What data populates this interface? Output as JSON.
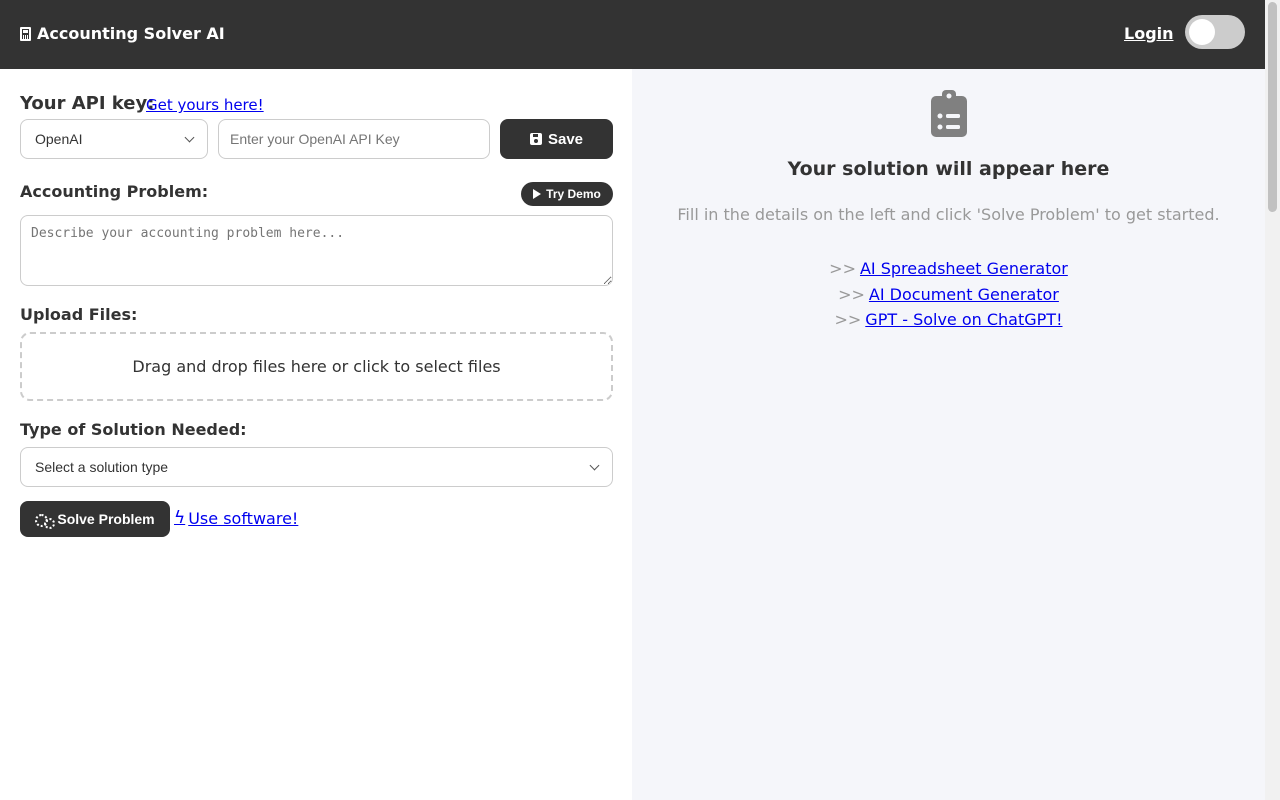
{
  "header": {
    "brand_title": "Accounting Solver AI",
    "login_label": "Login"
  },
  "api_section": {
    "label": "Your API key:",
    "link_text": "Get yours here!",
    "provider_selected": "OpenAI",
    "input_placeholder": "Enter your OpenAI API Key",
    "save_label": "Save"
  },
  "problem_section": {
    "label": "Accounting Problem:",
    "demo_label": "Try Demo",
    "textarea_placeholder": "Describe your accounting problem here..."
  },
  "upload_section": {
    "label": "Upload Files:",
    "dropzone_text": "Drag and drop files here or click to select files"
  },
  "solution_type_section": {
    "label": "Type of Solution Needed:",
    "selected": "Select a solution type"
  },
  "actions": {
    "solve_label": "Solve Problem",
    "software_link": "Use software!"
  },
  "result_panel": {
    "title": "Your solution will appear here",
    "subtitle": "Fill in the details on the left and click 'Solve Problem' to get started.",
    "links": [
      {
        "prefix": ">>",
        "label": "AI Spreadsheet Generator"
      },
      {
        "prefix": ">>",
        "label": "AI Document Generator"
      },
      {
        "prefix": ">>",
        "label": "GPT - Solve on ChatGPT!"
      }
    ]
  },
  "colors": {
    "header_bg": "#333333",
    "button_bg": "#333333",
    "link": "#0000ee",
    "right_panel_bg": "#f5f6fa",
    "muted_text": "#999999"
  },
  "icons": {
    "brand": "calculator-icon",
    "save": "floppy-disk-icon",
    "demo": "play-icon",
    "solve": "gears-icon",
    "software": "bolt-icon",
    "placeholder": "clipboard-list-icon"
  },
  "theme_toggle": {
    "on": false
  }
}
